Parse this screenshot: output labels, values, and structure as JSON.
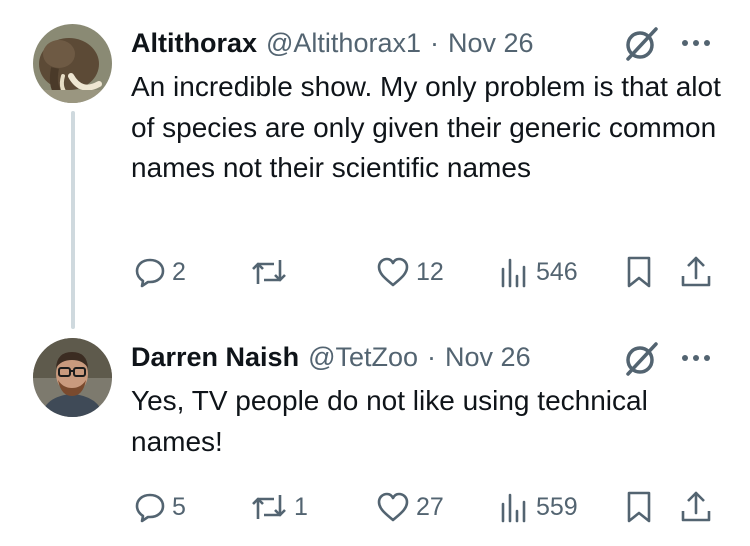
{
  "tweets": [
    {
      "name": "Altithorax",
      "handle": "@Altithorax1",
      "separator": "·",
      "date": "Nov 26",
      "text": "An incredible show. My only problem is that alot of species are only given their generic common names not their scientific names",
      "replies": "2",
      "reposts": "",
      "likes": "12",
      "views": "546"
    },
    {
      "name": "Darren Naish",
      "handle": "@TetZoo",
      "separator": "·",
      "date": "Nov 26",
      "text": "Yes, TV people do not like using technical names!",
      "replies": "5",
      "reposts": "1",
      "likes": "27",
      "views": "559"
    }
  ],
  "icons": {
    "more": "more-icon",
    "grok": "grok-icon",
    "reply": "reply-icon",
    "repost": "repost-icon",
    "like": "heart-icon",
    "views": "views-icon",
    "bookmark": "bookmark-icon",
    "share": "share-icon"
  },
  "colors": {
    "text": "#0f1419",
    "secondary": "#536471",
    "thread_line": "#cfd9de"
  }
}
